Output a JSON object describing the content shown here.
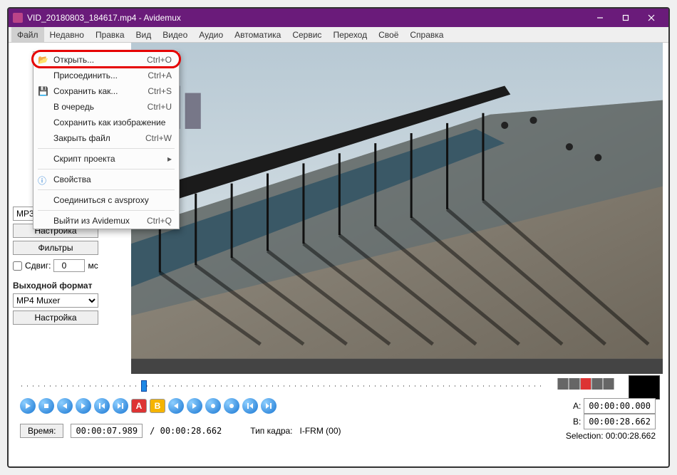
{
  "window": {
    "title": "VID_20180803_184617.mp4 - Avidemux"
  },
  "menubar": [
    "Файл",
    "Недавно",
    "Правка",
    "Вид",
    "Видео",
    "Аудио",
    "Автоматика",
    "Сервис",
    "Переход",
    "Своё",
    "Справка"
  ],
  "file_menu": {
    "open": {
      "label": "Открыть...",
      "shortcut": "Ctrl+O"
    },
    "append": {
      "label": "Присоединить...",
      "shortcut": "Ctrl+A"
    },
    "save_as": {
      "label": "Сохранить как...",
      "shortcut": "Ctrl+S"
    },
    "queue": {
      "label": "В очередь",
      "shortcut": "Ctrl+U"
    },
    "save_image": {
      "label": "Сохранить как изображение",
      "shortcut": ""
    },
    "close": {
      "label": "Закрыть файл",
      "shortcut": "Ctrl+W"
    },
    "script": {
      "label": "Скрипт проекта",
      "shortcut": ""
    },
    "properties": {
      "label": "Свойства",
      "shortcut": ""
    },
    "connect": {
      "label": "Соединиться с avsproxy",
      "shortcut": ""
    },
    "quit": {
      "label": "Выйти из Avidemux",
      "shortcut": "Ctrl+Q"
    }
  },
  "side": {
    "audio_codec": "MP3 (lame)",
    "configure": "Настройка",
    "filters": "Фильтры",
    "shift_label": "Сдвиг:",
    "shift_value": "0",
    "shift_unit": "мс",
    "output_label": "Выходной формат",
    "output_muxer": "MP4 Muxer",
    "configure2": "Настройка"
  },
  "status": {
    "time_btn": "Время:",
    "current_time": "00:00:07.989",
    "duration": "/ 00:00:28.662",
    "frame_type_label": "Тип кадра:",
    "frame_type": "I-FRM (00)",
    "a_label": "A:",
    "a_time": "00:00:00.000",
    "b_label": "B:",
    "b_time": "00:00:28.662",
    "selection_label": "Selection:",
    "selection_time": "00:00:28.662"
  }
}
